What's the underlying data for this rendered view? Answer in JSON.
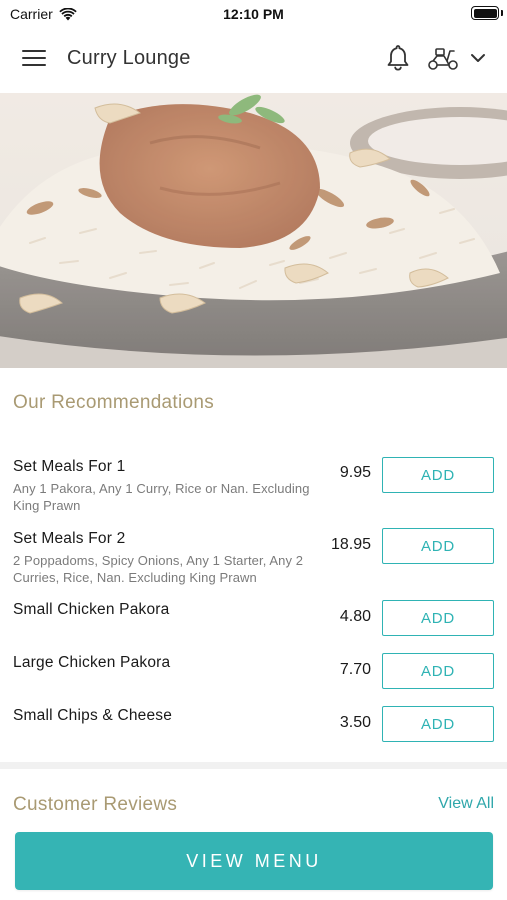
{
  "status_bar": {
    "carrier": "Carrier",
    "time": "12:10 PM"
  },
  "header": {
    "title": "Curry Lounge",
    "icons": [
      "menu-icon",
      "bell-icon",
      "scooter-icon",
      "chevron-down-icon"
    ]
  },
  "recommendations": {
    "title": "Our Recommendations",
    "items": [
      {
        "name": "Set Meals For 1",
        "description": "Any 1 Pakora, Any 1 Curry, Rice or Nan. Excluding King Prawn",
        "price": "9.95",
        "button": "ADD"
      },
      {
        "name": "Set Meals For 2",
        "description": "2 Poppadoms, Spicy Onions, Any 1 Starter, Any 2 Curries, Rice, Nan. Excluding King Prawn",
        "price": "18.95",
        "button": "ADD"
      },
      {
        "name": "Small Chicken Pakora",
        "description": "",
        "price": "4.80",
        "button": "ADD"
      },
      {
        "name": "Large Chicken Pakora",
        "description": "",
        "price": "7.70",
        "button": "ADD"
      },
      {
        "name": "Small Chips & Cheese",
        "description": "",
        "price": "3.50",
        "button": "ADD"
      }
    ]
  },
  "reviews": {
    "title": "Customer Reviews",
    "view_all": "View All"
  },
  "footer": {
    "view_menu": "VIEW MENU"
  },
  "colors": {
    "accent": "#35b4b4",
    "section_title": "#a99a73",
    "text": "#1a1a1a",
    "muted": "#7b7b7b"
  }
}
